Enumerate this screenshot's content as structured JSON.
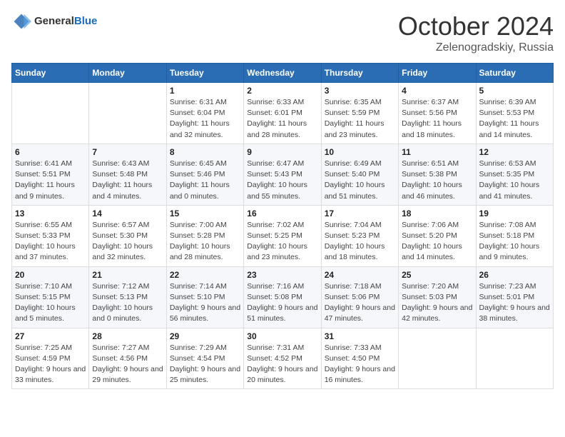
{
  "header": {
    "logo_general": "General",
    "logo_blue": "Blue",
    "title": "October 2024",
    "location": "Zelenogradskiy, Russia"
  },
  "weekdays": [
    "Sunday",
    "Monday",
    "Tuesday",
    "Wednesday",
    "Thursday",
    "Friday",
    "Saturday"
  ],
  "weeks": [
    [
      {
        "day": "",
        "info": ""
      },
      {
        "day": "",
        "info": ""
      },
      {
        "day": "1",
        "info": "Sunrise: 6:31 AM\nSunset: 6:04 PM\nDaylight: 11 hours and 32 minutes."
      },
      {
        "day": "2",
        "info": "Sunrise: 6:33 AM\nSunset: 6:01 PM\nDaylight: 11 hours and 28 minutes."
      },
      {
        "day": "3",
        "info": "Sunrise: 6:35 AM\nSunset: 5:59 PM\nDaylight: 11 hours and 23 minutes."
      },
      {
        "day": "4",
        "info": "Sunrise: 6:37 AM\nSunset: 5:56 PM\nDaylight: 11 hours and 18 minutes."
      },
      {
        "day": "5",
        "info": "Sunrise: 6:39 AM\nSunset: 5:53 PM\nDaylight: 11 hours and 14 minutes."
      }
    ],
    [
      {
        "day": "6",
        "info": "Sunrise: 6:41 AM\nSunset: 5:51 PM\nDaylight: 11 hours and 9 minutes."
      },
      {
        "day": "7",
        "info": "Sunrise: 6:43 AM\nSunset: 5:48 PM\nDaylight: 11 hours and 4 minutes."
      },
      {
        "day": "8",
        "info": "Sunrise: 6:45 AM\nSunset: 5:46 PM\nDaylight: 11 hours and 0 minutes."
      },
      {
        "day": "9",
        "info": "Sunrise: 6:47 AM\nSunset: 5:43 PM\nDaylight: 10 hours and 55 minutes."
      },
      {
        "day": "10",
        "info": "Sunrise: 6:49 AM\nSunset: 5:40 PM\nDaylight: 10 hours and 51 minutes."
      },
      {
        "day": "11",
        "info": "Sunrise: 6:51 AM\nSunset: 5:38 PM\nDaylight: 10 hours and 46 minutes."
      },
      {
        "day": "12",
        "info": "Sunrise: 6:53 AM\nSunset: 5:35 PM\nDaylight: 10 hours and 41 minutes."
      }
    ],
    [
      {
        "day": "13",
        "info": "Sunrise: 6:55 AM\nSunset: 5:33 PM\nDaylight: 10 hours and 37 minutes."
      },
      {
        "day": "14",
        "info": "Sunrise: 6:57 AM\nSunset: 5:30 PM\nDaylight: 10 hours and 32 minutes."
      },
      {
        "day": "15",
        "info": "Sunrise: 7:00 AM\nSunset: 5:28 PM\nDaylight: 10 hours and 28 minutes."
      },
      {
        "day": "16",
        "info": "Sunrise: 7:02 AM\nSunset: 5:25 PM\nDaylight: 10 hours and 23 minutes."
      },
      {
        "day": "17",
        "info": "Sunrise: 7:04 AM\nSunset: 5:23 PM\nDaylight: 10 hours and 18 minutes."
      },
      {
        "day": "18",
        "info": "Sunrise: 7:06 AM\nSunset: 5:20 PM\nDaylight: 10 hours and 14 minutes."
      },
      {
        "day": "19",
        "info": "Sunrise: 7:08 AM\nSunset: 5:18 PM\nDaylight: 10 hours and 9 minutes."
      }
    ],
    [
      {
        "day": "20",
        "info": "Sunrise: 7:10 AM\nSunset: 5:15 PM\nDaylight: 10 hours and 5 minutes."
      },
      {
        "day": "21",
        "info": "Sunrise: 7:12 AM\nSunset: 5:13 PM\nDaylight: 10 hours and 0 minutes."
      },
      {
        "day": "22",
        "info": "Sunrise: 7:14 AM\nSunset: 5:10 PM\nDaylight: 9 hours and 56 minutes."
      },
      {
        "day": "23",
        "info": "Sunrise: 7:16 AM\nSunset: 5:08 PM\nDaylight: 9 hours and 51 minutes."
      },
      {
        "day": "24",
        "info": "Sunrise: 7:18 AM\nSunset: 5:06 PM\nDaylight: 9 hours and 47 minutes."
      },
      {
        "day": "25",
        "info": "Sunrise: 7:20 AM\nSunset: 5:03 PM\nDaylight: 9 hours and 42 minutes."
      },
      {
        "day": "26",
        "info": "Sunrise: 7:23 AM\nSunset: 5:01 PM\nDaylight: 9 hours and 38 minutes."
      }
    ],
    [
      {
        "day": "27",
        "info": "Sunrise: 7:25 AM\nSunset: 4:59 PM\nDaylight: 9 hours and 33 minutes."
      },
      {
        "day": "28",
        "info": "Sunrise: 7:27 AM\nSunset: 4:56 PM\nDaylight: 9 hours and 29 minutes."
      },
      {
        "day": "29",
        "info": "Sunrise: 7:29 AM\nSunset: 4:54 PM\nDaylight: 9 hours and 25 minutes."
      },
      {
        "day": "30",
        "info": "Sunrise: 7:31 AM\nSunset: 4:52 PM\nDaylight: 9 hours and 20 minutes."
      },
      {
        "day": "31",
        "info": "Sunrise: 7:33 AM\nSunset: 4:50 PM\nDaylight: 9 hours and 16 minutes."
      },
      {
        "day": "",
        "info": ""
      },
      {
        "day": "",
        "info": ""
      }
    ]
  ]
}
